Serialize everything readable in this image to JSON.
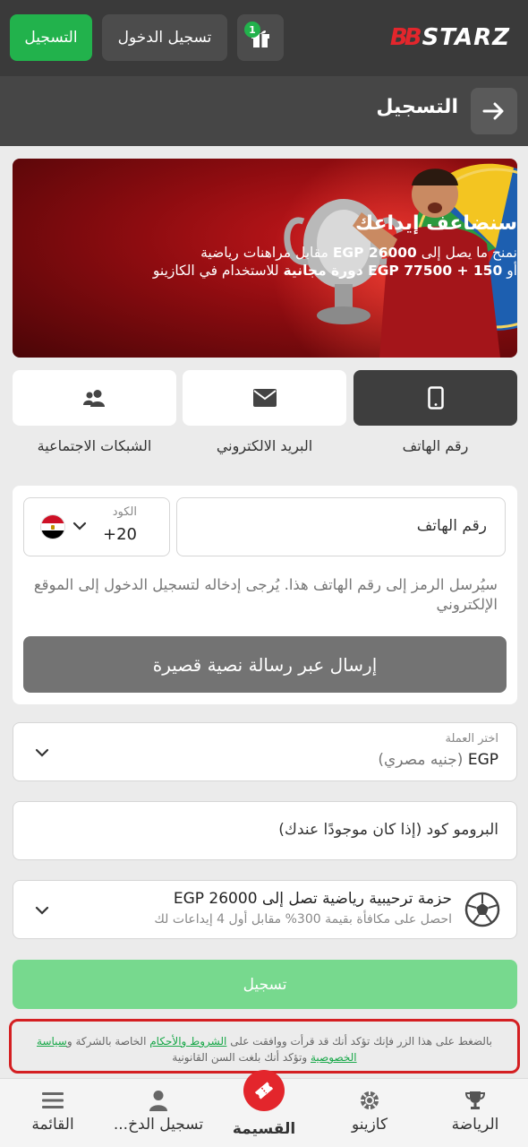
{
  "header": {
    "logo_prefix": "BB",
    "logo_text": "STARZ",
    "register_label": "التسجيل",
    "login_label": "تسجيل الدخول",
    "gift_badge": "1"
  },
  "subheader": {
    "title": "التسجيل"
  },
  "banner": {
    "title": "سنضاعف إيداعك",
    "line1_pre": "نمنح ما يصل إلى",
    "line1_bold": "EGP 26000",
    "line1_post": "مقابل مراهنات رياضية",
    "line2_pre": "أو",
    "line2_bold": "EGP 77500 + 150 دورة مجانية",
    "line2_post": "للاستخدام في الكازينو"
  },
  "methods": [
    {
      "label": "رقم الهاتف",
      "icon": "phone-icon",
      "active": true
    },
    {
      "label": "البريد الالكتروني",
      "icon": "envelope-icon",
      "active": false
    },
    {
      "label": "الشبكات الاجتماعية",
      "icon": "users-icon",
      "active": false
    }
  ],
  "phone_form": {
    "phone_placeholder": "رقم الهاتف",
    "code_label": "الكود",
    "code_value": "+20",
    "note": "سيُرسل الرمز إلى رقم الهاتف هذا. يُرجى إدخاله لتسجيل الدخول إلى الموقع الإلكتروني",
    "sms_button": "إرسال عبر رسالة نصية قصيرة"
  },
  "currency": {
    "label": "اختر العملة",
    "code": "EGP",
    "name": "(جنيه مصري)"
  },
  "promo": {
    "placeholder": "البرومو كود (إذا كان موجودًا عندك)"
  },
  "bonus": {
    "title": "حزمة ترحيبية رياضية تصل إلى EGP 26000",
    "subtitle": "احصل على مكافأة بقيمة 300% مقابل أول 4 إيداعات لك"
  },
  "submit_label": "تسجيل",
  "consent": {
    "part1": "بالضغط على هذا الزر فإنك تؤكد أنك قد قرأت ووافقت على",
    "terms_link": "الشروط والأحكام",
    "part2": "الخاصة بالشركة و",
    "privacy_link": "سياسة الخصوصية",
    "part3": "وتؤكد أنك بلغت السن القانونية"
  },
  "bottom_nav": [
    {
      "label": "الرياضة",
      "icon": "trophy-icon"
    },
    {
      "label": "كازينو",
      "icon": "chip-icon"
    },
    {
      "label": "القسيمة",
      "icon": "ticket-icon"
    },
    {
      "label": "تسجيل الدخ...",
      "icon": "user-icon"
    },
    {
      "label": "القائمة",
      "icon": "menu-icon"
    }
  ],
  "colors": {
    "accent_green": "#22b24c",
    "brand_red": "#e3262c",
    "consent_border": "#d41f22"
  }
}
